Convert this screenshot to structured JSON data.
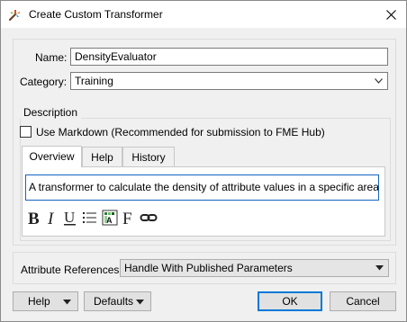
{
  "window": {
    "title": "Create Custom Transformer",
    "app_icon": "fme-transformer-icon",
    "close_icon": "close-icon"
  },
  "form": {
    "name_label": "Name:",
    "name_value": "DensityEvaluator",
    "category_label": "Category:",
    "category_value": "Training"
  },
  "description": {
    "legend": "Description",
    "markdown_checkbox_label": "Use Markdown (Recommended for submission to FME Hub)",
    "markdown_checked": false,
    "tabs": [
      {
        "label": "Overview",
        "active": true
      },
      {
        "label": "Help",
        "active": false
      },
      {
        "label": "History",
        "active": false
      }
    ],
    "overview_text": "A transformer to calculate the density of attribute values in a specific area.",
    "toolbar_icons": [
      "bold-icon",
      "italic-icon",
      "underline-icon",
      "bullet-list-icon",
      "color-picker-icon",
      "font-icon",
      "link-icon"
    ]
  },
  "attributes": {
    "label": "Attribute References:",
    "value": "Handle With Published Parameters"
  },
  "buttons": {
    "help": "Help",
    "defaults": "Defaults",
    "ok": "OK",
    "cancel": "Cancel"
  },
  "colors": {
    "accent": "#0078d7",
    "editor_border": "#1565c0"
  }
}
